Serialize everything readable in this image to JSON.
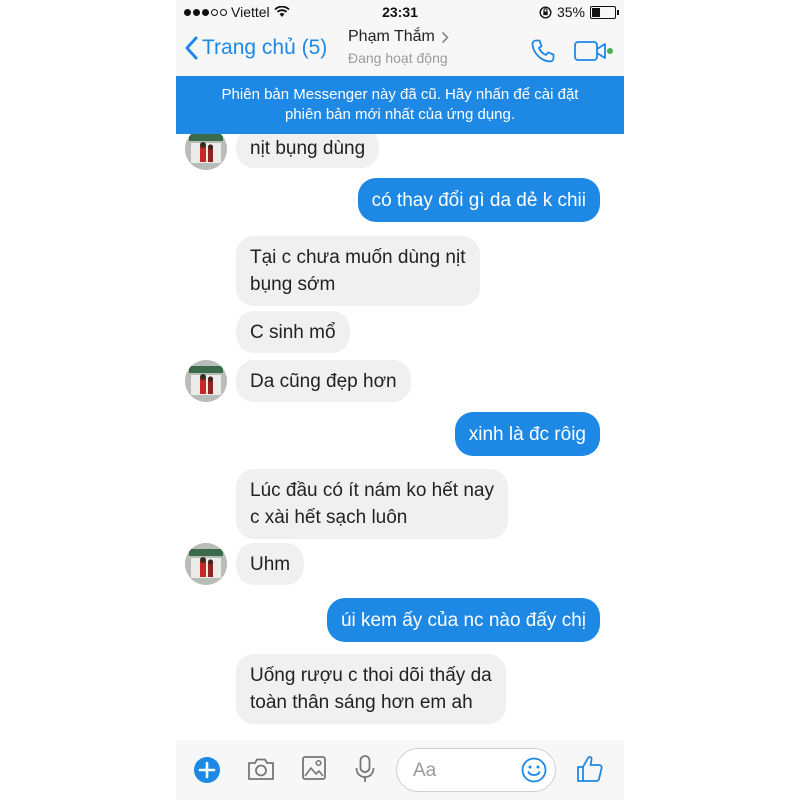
{
  "status_bar": {
    "carrier": "Viettel",
    "time": "23:31",
    "battery": "35%",
    "battery_level": 0.35
  },
  "nav": {
    "back_label": "Trang chủ (5)",
    "contact_name": "Phạm Thắm",
    "contact_status": "Đang hoạt động"
  },
  "banner": {
    "line1": "Phiên bản Messenger này đã cũ. Hãy nhấn để cài đặt",
    "line2": "phiên bản mới nhất của ứng dụng."
  },
  "messages": [
    {
      "from": "contact",
      "lines": [
        "nịt bụng dùng"
      ]
    },
    {
      "from": "me",
      "lines": [
        "có thay đổi gì da dẻ k chii"
      ]
    },
    {
      "from": "contact",
      "lines": [
        "Tại c chưa muốn dùng nịt",
        "bụng sớm"
      ]
    },
    {
      "from": "contact",
      "lines": [
        "C sinh mổ"
      ]
    },
    {
      "from": "contact",
      "lines": [
        "Da cũng đẹp hơn"
      ]
    },
    {
      "from": "me",
      "lines": [
        "xinh là đc rôig"
      ]
    },
    {
      "from": "contact",
      "lines": [
        "Lúc đầu có ít nám ko hết nay",
        "c xài hết sạch luôn"
      ]
    },
    {
      "from": "contact",
      "lines": [
        "Uhm"
      ]
    },
    {
      "from": "me",
      "lines": [
        "úi kem ấy của nc nào đấy chị"
      ]
    },
    {
      "from": "contact",
      "lines": [
        "Uống rượu c thoi dõi thấy da",
        "toàn thân sáng hơn em ah"
      ]
    }
  ],
  "composer": {
    "placeholder": "Aa"
  },
  "colors": {
    "accent": "#1e88e5",
    "incoming_bubble": "#f0f0f0",
    "online": "#4caf50"
  }
}
